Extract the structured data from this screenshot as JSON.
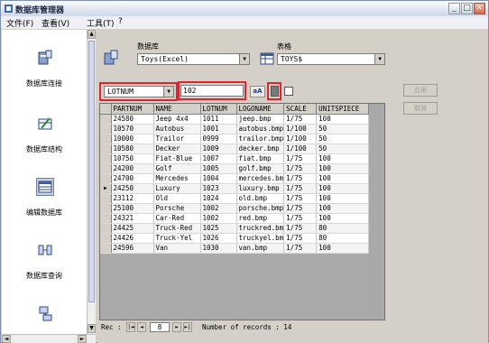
{
  "app": {
    "title": "数据库管理器"
  },
  "window_buttons": {
    "minimize": "_",
    "maximize": "□",
    "close": "×"
  },
  "menu": [
    "文件(F)",
    "查看(V)",
    "工具(T)",
    "?"
  ],
  "sidebar": {
    "items": [
      {
        "label": "数据库连接",
        "icon": "database-connect-icon"
      },
      {
        "label": "数据库结构",
        "icon": "table-structure-icon"
      },
      {
        "label": "编辑数据库",
        "icon": "edit-database-icon",
        "active": true
      },
      {
        "label": "数据库查询",
        "icon": "query-icon"
      },
      {
        "label": "",
        "icon": "network-icon"
      }
    ]
  },
  "header": {
    "database_label": "数据库",
    "database_value": "Toys(Excel)",
    "table_label": "表格",
    "table_value": "TOYS$"
  },
  "filter": {
    "field": "LOTNUM",
    "value": "102"
  },
  "buttons": {
    "apply": "应用",
    "cancel": "取消",
    "search": "aA"
  },
  "table": {
    "columns": [
      "PARTNUM",
      "NAME",
      "LOTNUM",
      "LOGONAME",
      "SCALE",
      "UNITSPIECE"
    ],
    "current_row": 7,
    "rows": [
      [
        "24580",
        "Jeep 4x4",
        "1011",
        "jeep.bmp",
        "1/75",
        "100"
      ],
      [
        "10570",
        "Autobus",
        "1001",
        "autobus.bmp",
        "1/100",
        "50"
      ],
      [
        "10000",
        "Trailor",
        "0999",
        "trailor.bmp",
        "1/100",
        "50"
      ],
      [
        "10580",
        "Decker",
        "1009",
        "decker.bmp",
        "1/100",
        "50"
      ],
      [
        "10750",
        "Fiat-Blue",
        "1007",
        "fiat.bmp",
        "1/75",
        "100"
      ],
      [
        "24200",
        "Golf",
        "1005",
        "golf.bmp",
        "1/75",
        "100"
      ],
      [
        "24700",
        "Mercedes",
        "1004",
        "mercedes.bm",
        "1/75",
        "100"
      ],
      [
        "24250",
        "Luxury",
        "1023",
        "luxury.bmp",
        "1/75",
        "100"
      ],
      [
        "23112",
        "Old",
        "1024",
        "old.bmp",
        "1/75",
        "100"
      ],
      [
        "25100",
        "Porsche",
        "1002",
        "porsche.bmp",
        "1/75",
        "100"
      ],
      [
        "24321",
        "Car-Red",
        "1002",
        "red.bmp",
        "1/75",
        "100"
      ],
      [
        "24425",
        "Truck-Red",
        "1025",
        "truckred.bm",
        "1/75",
        "80"
      ],
      [
        "24426",
        "Truck-Yel",
        "1026",
        "truckyel.bm",
        "1/75",
        "80"
      ],
      [
        "24596",
        "Van",
        "1030",
        "van.bmp",
        "1/75",
        "100"
      ]
    ]
  },
  "navigator": {
    "rec_label": "Rec :",
    "first": "|◄",
    "prev": "◄",
    "current": "8",
    "next": "►",
    "last": "►|",
    "count_label": "Number of records : 14"
  },
  "colors": {
    "highlight": "#e0242f",
    "title_text": "#1d2a44"
  }
}
